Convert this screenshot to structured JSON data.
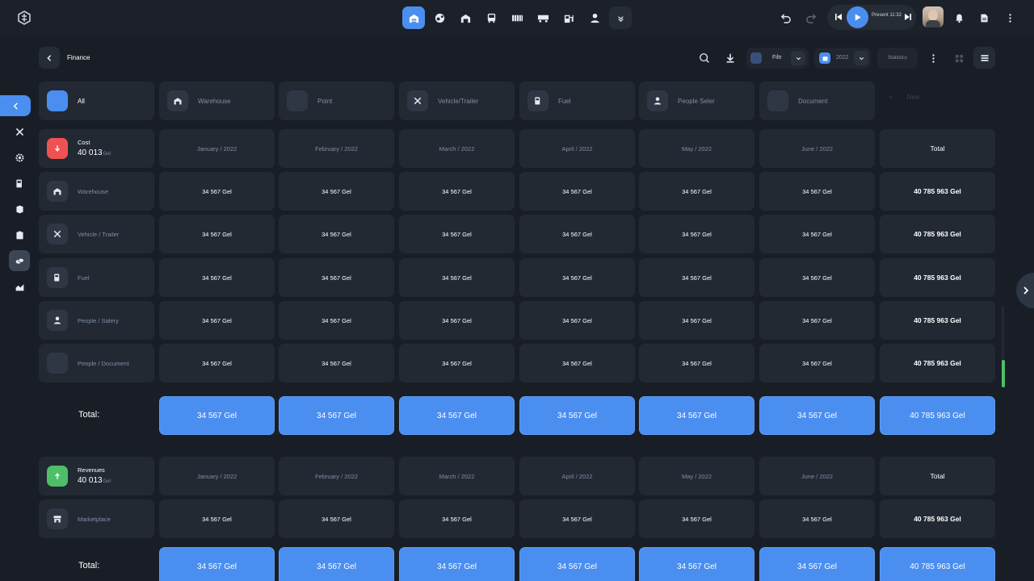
{
  "topbar": {
    "player_status": "Present 11:32"
  },
  "header": {
    "title": "Finance",
    "filter_label": "Filtr",
    "year_label": "2022",
    "statistics_label": "Statistics"
  },
  "categories": [
    {
      "label": "All",
      "icon": "grid-icon"
    },
    {
      "label": "Warehouse",
      "icon": "warehouse-icon"
    },
    {
      "label": "Point",
      "icon": "point-icon"
    },
    {
      "label": "Vehicle/Trailer",
      "icon": "tools-icon"
    },
    {
      "label": "Fuel",
      "icon": "fuel-icon"
    },
    {
      "label": "People Seler",
      "icon": "person-icon"
    },
    {
      "label": "Document",
      "icon": "document-icon"
    }
  ],
  "new_tab_label": "New",
  "months": [
    "January / 2022",
    "February / 2022",
    "March / 2022",
    "April / 2022",
    "May / 2022",
    "June / 2022"
  ],
  "total_header": "Total",
  "total_label": "Total:",
  "cost": {
    "name": "Cost",
    "amount": "40 013",
    "currency": "Gel",
    "color": "#ef5253",
    "rows": [
      {
        "label": "Warehouse",
        "icon": "warehouse-icon",
        "values": [
          "34 567 Gel",
          "34 567 Gel",
          "34 567 Gel",
          "34 567 Gel",
          "34 567 Gel",
          "34 567 Gel"
        ],
        "total": "40 785 963 Gel"
      },
      {
        "label": "Vehicle / Trailer",
        "icon": "tools-icon",
        "values": [
          "34 567 Gel",
          "34 567 Gel",
          "34 567 Gel",
          "34 567 Gel",
          "34 567 Gel",
          "34 567 Gel"
        ],
        "total": "40 785 963 Gel"
      },
      {
        "label": "Fuel",
        "icon": "fuel-icon",
        "values": [
          "34 567 Gel",
          "34 567 Gel",
          "34 567 Gel",
          "34 567 Gel",
          "34 567 Gel",
          "34 567 Gel"
        ],
        "total": "40 785 963 Gel"
      },
      {
        "label": "People / Salery",
        "icon": "person-icon",
        "values": [
          "34 567 Gel",
          "34 567 Gel",
          "34 567 Gel",
          "34 567 Gel",
          "34 567 Gel",
          "34 567 Gel"
        ],
        "total": "40 785 963 Gel"
      },
      {
        "label": "People / Document",
        "icon": "document-icon",
        "values": [
          "34 567 Gel",
          "34 567 Gel",
          "34 567 Gel",
          "34 567 Gel",
          "34 567 Gel",
          "34 567 Gel"
        ],
        "total": "40 785 963 Gel"
      }
    ],
    "totals": [
      "34 567 Gel",
      "34 567 Gel",
      "34 567 Gel",
      "34 567 Gel",
      "34 567 Gel",
      "34 567 Gel"
    ],
    "grand_total": "40 785 963 Gel"
  },
  "revenues": {
    "name": "Revenues",
    "amount": "40 013",
    "currency": "Gel",
    "color": "#4cbf68",
    "rows": [
      {
        "label": "Marketplace",
        "icon": "store-icon",
        "values": [
          "34 567 Gel",
          "34 567 Gel",
          "34 567 Gel",
          "34 567 Gel",
          "34 567 Gel",
          "34 567 Gel"
        ],
        "total": "40 785 963 Gel"
      }
    ],
    "totals": [
      "34 567 Gel",
      "34 567 Gel",
      "34 567 Gel",
      "34 567 Gel",
      "34 567 Gel",
      "34 567 Gel"
    ],
    "grand_total": "40 785 963 Gel"
  },
  "colors": {
    "accent": "#4a8ef0",
    "background": "#191e26",
    "card": "#232933"
  }
}
